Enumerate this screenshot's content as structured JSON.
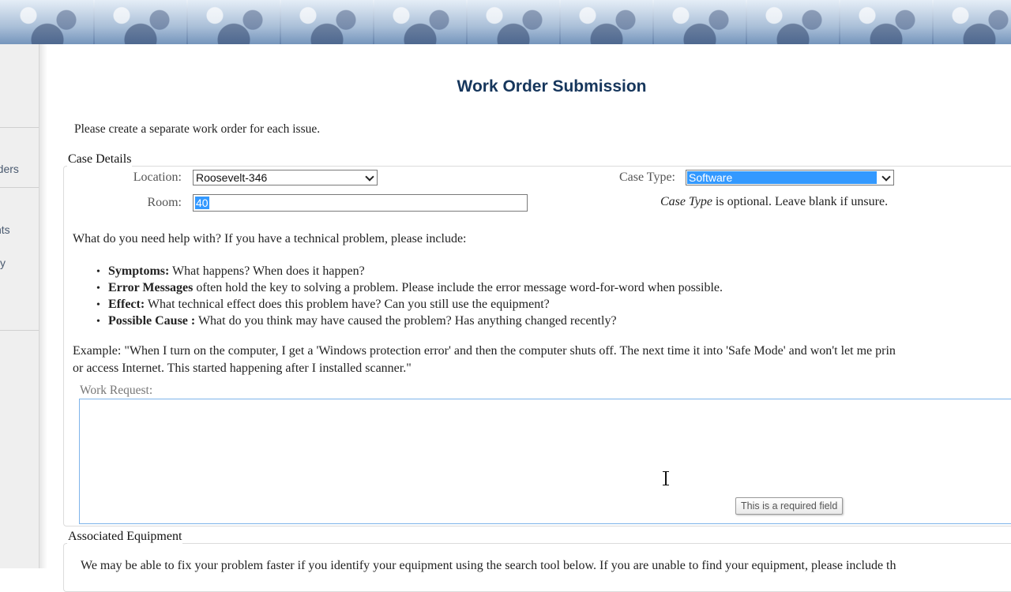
{
  "page": {
    "title": "Work Order Submission",
    "intro": "Please create a separate work order for each issue."
  },
  "leftnav": {
    "fragments": [
      "rders",
      "nts",
      "y"
    ]
  },
  "case_details": {
    "legend": "Case Details",
    "location_label": "Location:",
    "location_value": "Roosevelt-346",
    "room_label": "Room:",
    "room_value": "40",
    "case_type_label": "Case Type:",
    "case_type_value": "Software",
    "case_type_note_italic": "Case Type",
    "case_type_note_rest": " is optional.  Leave blank if unsure.",
    "help_heading": "What do you need help with?  If you have a technical problem, please include:",
    "bullets": [
      {
        "bold": "Symptoms:",
        "text": "  What happens? When does it happen?"
      },
      {
        "bold": "Error Messages",
        "text": " often hold the key to solving a problem.  Please include the error message word-for-word when possible."
      },
      {
        "bold": "Effect:",
        "text": "  What technical effect does this problem have?  Can you still use the equipment?"
      },
      {
        "bold": "Possible Cause :",
        "text": "  What do you think may have caused the problem?  Has anything changed recently?"
      }
    ],
    "example_line1": "Example:  \"When I turn on the computer, I get a 'Windows protection error' and then the computer shuts off.  The next time it into 'Safe Mode' and won't let me prin",
    "example_line2": "or access Internet.  This started happening after I installed scanner.\"",
    "work_request_label": "Work Request:",
    "work_request_value": "",
    "tooltip": "This is a required field"
  },
  "associated_equipment": {
    "legend": "Associated Equipment",
    "text": "We may be able to fix your problem faster if you identify your equipment using the search tool below.  If you are unable to find your equipment, please include th"
  },
  "colors": {
    "title": "#16365c",
    "selection": "#3399ff",
    "focus_border": "#7eb4ea"
  }
}
